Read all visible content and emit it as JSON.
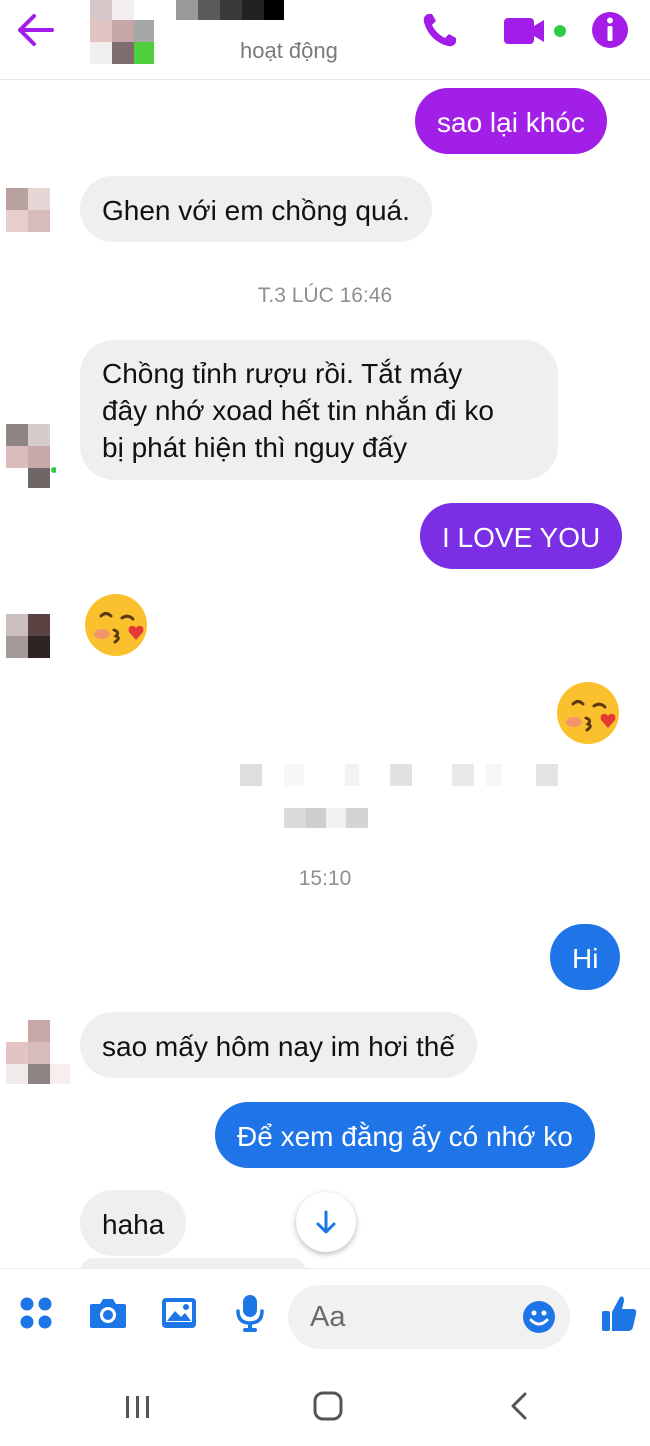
{
  "header": {
    "status_text": "hoạt động",
    "icons": [
      "back-arrow-icon",
      "phone-icon",
      "video-camera-icon",
      "info-icon"
    ],
    "accent_color": "#a31ce8",
    "online_color": "#31cc46"
  },
  "messages": [
    {
      "id": "m1",
      "side": "out",
      "style": "purple",
      "text": "sao lại khóc"
    },
    {
      "id": "m2",
      "side": "in",
      "text": "Ghen với em chồng quá."
    },
    {
      "id": "t1",
      "type": "timestamp",
      "text": "T.3 LÚC 16:46"
    },
    {
      "id": "m3",
      "side": "in",
      "lines": [
        "Chồng tỉnh rượu rồi. Tắt máy",
        "đây nhớ xoad hết tin nhắn đi ko",
        "bị phát hiện thì nguy đấy"
      ]
    },
    {
      "id": "m4",
      "side": "out",
      "style": "indigo",
      "text": "I LOVE YOU"
    },
    {
      "id": "m5",
      "side": "in",
      "type": "emoji",
      "emoji": "kissing-face-with-heart-emoji"
    },
    {
      "id": "m6",
      "side": "out",
      "type": "emoji",
      "emoji": "kissing-face-with-heart-emoji"
    },
    {
      "id": "t2",
      "type": "timestamp",
      "text": "15:10"
    },
    {
      "id": "m7",
      "side": "out",
      "style": "blue",
      "text": "Hi"
    },
    {
      "id": "m8",
      "side": "in",
      "text": "sao mấy hôm nay im hơi thế"
    },
    {
      "id": "m9",
      "side": "out",
      "style": "blue",
      "text": "Để xem đằng ấy có nhớ ko"
    },
    {
      "id": "m10",
      "side": "in",
      "text": "haha"
    }
  ],
  "composer": {
    "placeholder": "Aa",
    "icons": [
      "apps-grid-icon",
      "camera-icon",
      "gallery-icon",
      "microphone-icon",
      "emoji-icon",
      "thumbs-up-icon"
    ],
    "accent_color": "#1c76e6"
  },
  "navbar": {
    "icons": [
      "recent-apps-icon",
      "home-icon",
      "back-icon"
    ]
  }
}
